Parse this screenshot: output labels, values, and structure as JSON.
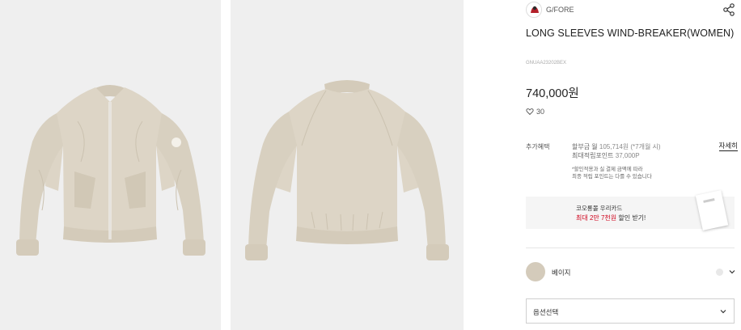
{
  "gallery": {
    "images": [
      {
        "alt": "front-view",
        "icon": "jacket-front"
      },
      {
        "alt": "back-view",
        "icon": "jacket-back"
      }
    ]
  },
  "product": {
    "brand": "G/FORE",
    "title": "LONG SLEEVES WIND-BREAKER(WOMEN)",
    "sku": "GNUAA23202BEX",
    "price": "740,000원",
    "likes": "30"
  },
  "benefit": {
    "label": "추가혜택",
    "installment_prefix": "할부금 월 ",
    "installment_value": "105,714원 (*7개월 시)",
    "points_prefix": "최대적립포인트 ",
    "points_value": "37,000P",
    "detail_link": "자세히",
    "note_line1": "*할인적용과 실 결제 금액에 따라",
    "note_line2": "최종 적립 포인트는 다를 수 있습니다"
  },
  "card_banner": {
    "title": "코오롱몰 우리카드",
    "sub_red": "최대 2만 7천원",
    "sub_rest": " 할인 받기!"
  },
  "color_option": {
    "label": "베이지",
    "swatch_color": "#d4cbbb"
  },
  "option_select": {
    "label": "옵션선택"
  },
  "colors": {
    "jacket": "#ddd5c6",
    "background": "#efefef",
    "accent_red": "#d0021b"
  }
}
